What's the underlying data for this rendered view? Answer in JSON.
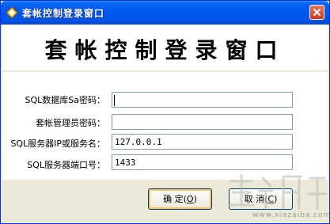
{
  "window": {
    "title": "套帐控制登录窗口"
  },
  "banner": {
    "text": "套帐控制登录窗口"
  },
  "form": {
    "sa_password": {
      "label": "SQL数据库Sa密码：",
      "value": ""
    },
    "admin_password": {
      "label": "套帐管理员密码：",
      "value": ""
    },
    "server_ip": {
      "label": "SQL服务器IP或服务名：",
      "value": "127.0.0.1"
    },
    "server_port": {
      "label": "SQL服务器端口号：",
      "value": "1433"
    }
  },
  "buttons": {
    "ok": {
      "label": "确 定(",
      "key": "O",
      "end": ")"
    },
    "cancel": {
      "label": "取 消(",
      "key": "C",
      "end": ")"
    }
  },
  "watermark": {
    "url": "www.xiazaiba.com"
  },
  "colors": {
    "titlebar": "#0055e8",
    "dialog": "#ece9d8",
    "field_border": "#7f9db9",
    "close": "#c8381d"
  },
  "icons": {
    "app": "app-icon",
    "close": "close-icon"
  }
}
